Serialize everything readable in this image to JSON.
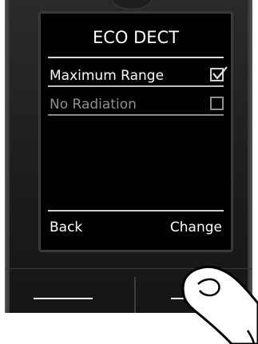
{
  "screen": {
    "title": "ECO DECT",
    "options": [
      {
        "label": "Maximum Range",
        "checked": true
      },
      {
        "label": "No Radiation",
        "checked": false
      }
    ],
    "softkeys": {
      "left": "Back",
      "right": "Change"
    }
  },
  "colors": {
    "screen_bg": "#000000",
    "text": "#ffffff",
    "disabled_text": "#8e8e8e",
    "phone_body": "#1c1c1c"
  },
  "icons": [
    "checkbox-checked-icon",
    "checkbox-empty-icon",
    "pointing-hand-icon"
  ]
}
